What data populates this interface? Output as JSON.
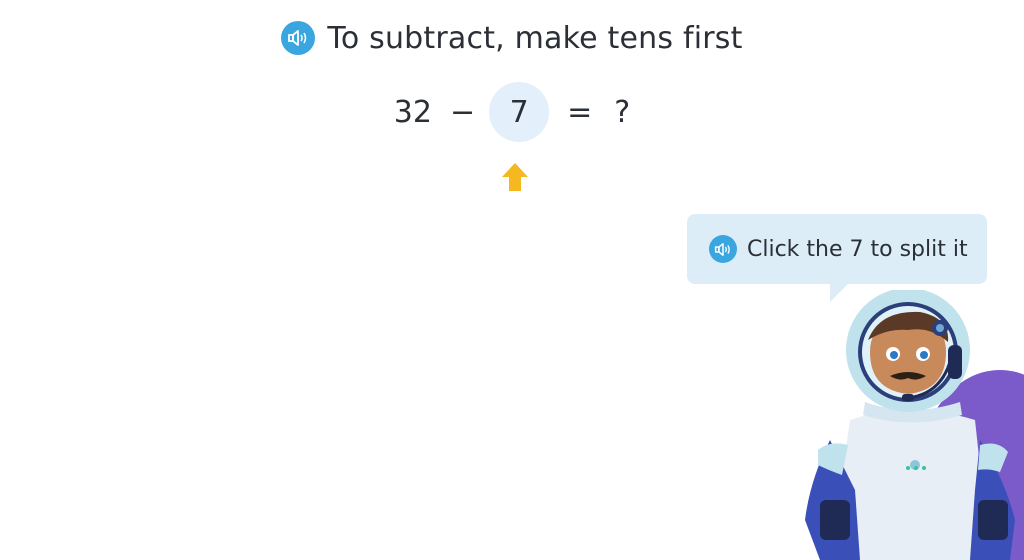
{
  "header": {
    "title": "To subtract, make tens first",
    "audio_icon": "speaker-icon"
  },
  "equation": {
    "minuend": "32",
    "operator": "−",
    "subtrahend": "7",
    "equals": "=",
    "result": "?"
  },
  "hint": {
    "arrow_icon": "arrow-up-icon",
    "arrow_color": "#f5b820"
  },
  "bubble": {
    "text": "Click the 7 to split it",
    "audio_icon": "speaker-icon"
  },
  "colors": {
    "accent_blue": "#3aa6e0",
    "circle_bg": "#e3f0fb",
    "bubble_bg": "#dcedf8",
    "character_purple": "#7a5bc9"
  }
}
